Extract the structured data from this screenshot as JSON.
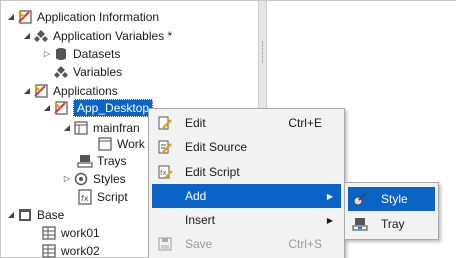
{
  "tree": {
    "application_information": "Application Information",
    "application_variables": "Application Variables *",
    "datasets": "Datasets",
    "variables": "Variables",
    "applications": "Applications",
    "app_desktop": "App_Desktop",
    "mainframe": "mainfran",
    "workarea": "Work",
    "trays": "Trays",
    "styles": "Styles",
    "script": "Script",
    "base": "Base",
    "work01": "work01",
    "work02": "work02"
  },
  "context_menu": {
    "edit": "Edit",
    "edit_shortcut": "Ctrl+E",
    "edit_source": "Edit Source",
    "edit_script": "Edit Script",
    "add": "Add",
    "insert": "Insert",
    "save": "Save",
    "save_shortcut": "Ctrl+S"
  },
  "add_submenu": {
    "style": "Style",
    "tray": "Tray"
  },
  "colors": {
    "selection": "#0a64c8",
    "menu_bg": "#f2f2f2",
    "disabled_text": "#9a9a9a"
  }
}
